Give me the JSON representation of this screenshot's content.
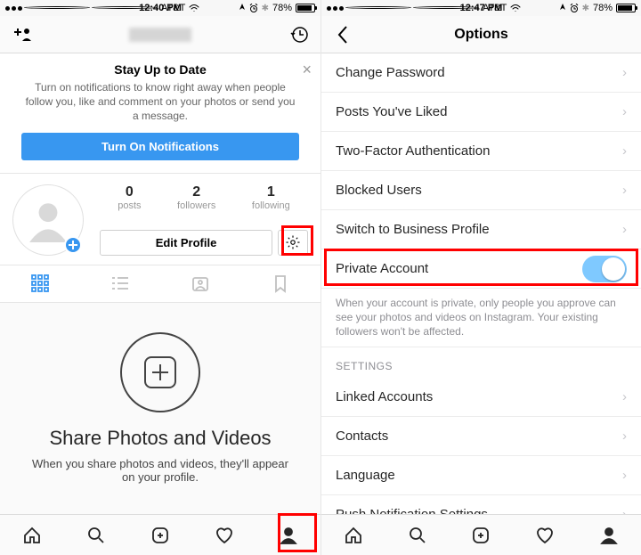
{
  "left": {
    "status": {
      "carrier": "AT&T",
      "time": "12:40 PM",
      "battery": "78%"
    },
    "promo": {
      "title": "Stay Up to Date",
      "body": "Turn on notifications to know right away when people follow you, like and comment on your photos or send you a message.",
      "button": "Turn On Notifications"
    },
    "stats": {
      "posts": {
        "value": "0",
        "label": "posts"
      },
      "followers": {
        "value": "2",
        "label": "followers"
      },
      "following": {
        "value": "1",
        "label": "following"
      }
    },
    "edit_profile": "Edit Profile",
    "empty": {
      "title": "Share Photos and Videos",
      "body": "When you share photos and videos, they'll appear on your profile."
    }
  },
  "right": {
    "status": {
      "carrier": "AT&T",
      "time": "12:47 PM",
      "battery": "78%"
    },
    "title": "Options",
    "items": {
      "change_password": "Change Password",
      "posts_liked": "Posts You've Liked",
      "two_factor": "Two-Factor Authentication",
      "blocked": "Blocked Users",
      "switch_biz": "Switch to Business Profile",
      "private": "Private Account",
      "private_desc": "When your account is private, only people you approve can see your photos and videos on Instagram. Your existing followers won't be affected.",
      "section_settings": "SETTINGS",
      "linked": "Linked Accounts",
      "contacts": "Contacts",
      "language": "Language",
      "push": "Push Notification Settings"
    }
  }
}
